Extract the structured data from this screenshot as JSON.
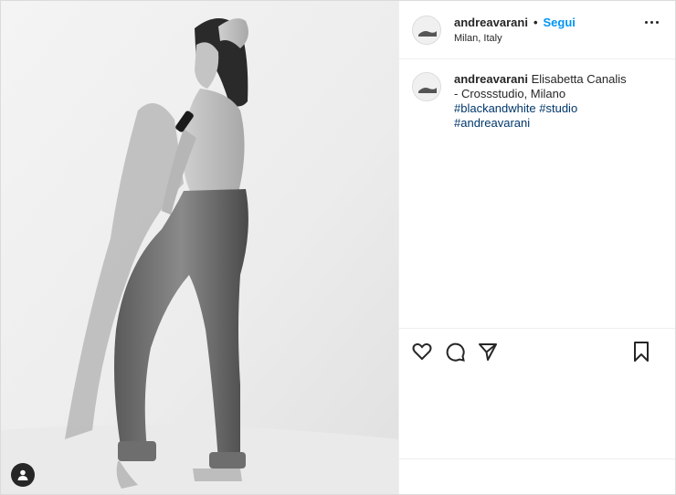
{
  "post": {
    "username": "andreavarani",
    "separator": "•",
    "follow_label": "Segui",
    "location": "Milan, Italy",
    "caption": {
      "username": "andreavarani",
      "text": "Elisabetta Canalis - Crossstudio, Milano",
      "hashtags": [
        "#blackandwhite",
        "#studio",
        "#andreavarani"
      ]
    }
  },
  "icons": {
    "more": "more-options-icon",
    "like": "heart-icon",
    "comment": "comment-icon",
    "share": "share-icon",
    "save": "bookmark-icon",
    "tagged_people": "user-tag-icon"
  },
  "colors": {
    "link": "#0095f6",
    "hashtag": "#00376b",
    "text": "#262626",
    "border": "#dbdbdb"
  }
}
